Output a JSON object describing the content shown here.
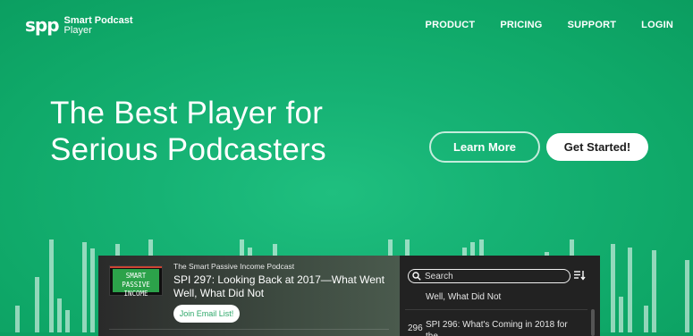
{
  "brand": {
    "mark": "spp",
    "name_line1": "Smart Podcast",
    "name_line2": "Player"
  },
  "nav": {
    "items": [
      {
        "label": "PRODUCT"
      },
      {
        "label": "PRICING"
      },
      {
        "label": "SUPPORT"
      },
      {
        "label": "LOGIN"
      }
    ]
  },
  "hero": {
    "title_line1": "The Best Player for",
    "title_line2": "Serious Podcasters",
    "learn_more": "Learn More",
    "get_started": "Get Started!"
  },
  "player": {
    "cover_text": "SMART PASSIVE INCOME",
    "podcast_name": "The Smart Passive Income Podcast",
    "episode_title": "SPI 297: Looking Back at 2017—What Went Well, What Did Not",
    "join_button": "Join Email List!",
    "search_placeholder": "Search",
    "list": [
      {
        "number": "",
        "title": "Well, What Did Not"
      },
      {
        "number": "296",
        "title": "SPI 296: What's Coming in 2018 for the"
      }
    ]
  },
  "colors": {
    "background": "#15b070",
    "accent_text": "#2ea86a",
    "player_bg": "#262626"
  },
  "icons": {
    "search": "search-icon",
    "sort": "sort-icon"
  }
}
